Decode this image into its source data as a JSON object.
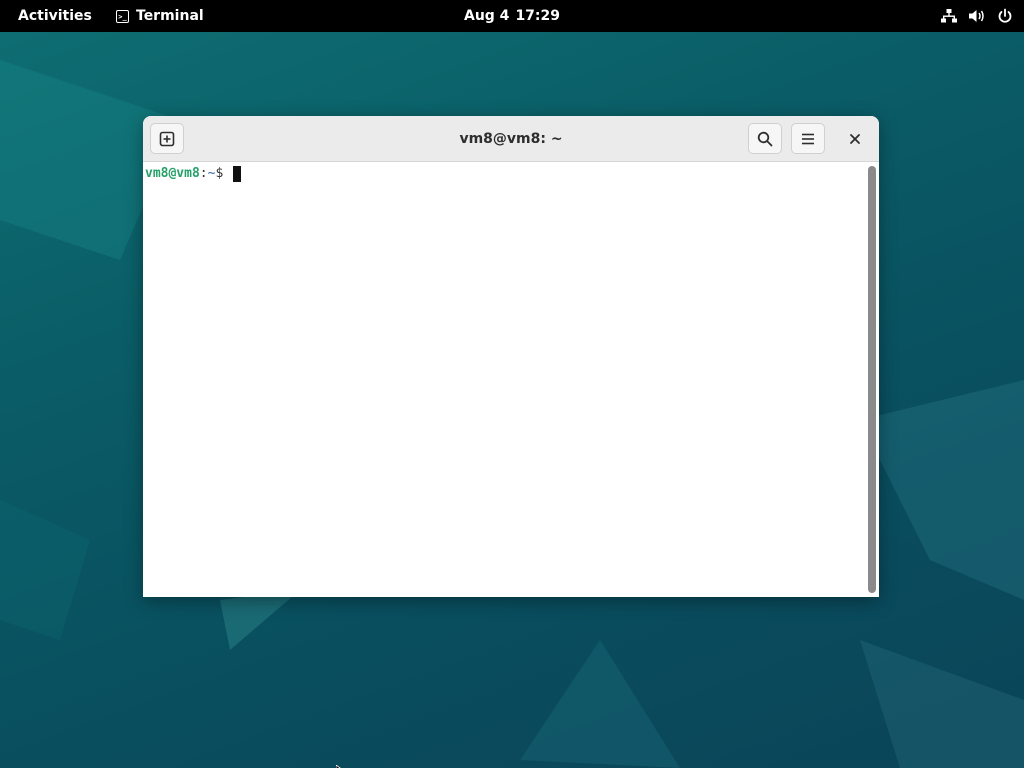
{
  "topbar": {
    "activities_label": "Activities",
    "app_name": "Terminal",
    "app_icon": "terminal-icon",
    "clock_date": "Aug 4",
    "clock_time": "17:29",
    "tray_icons": [
      "network-icon",
      "volume-icon",
      "power-icon"
    ]
  },
  "window": {
    "title": "vm8@vm8: ~",
    "buttons": {
      "new_tab_icon": "new-tab-icon",
      "search_icon": "search-icon",
      "menu_icon": "hamburger-menu-icon",
      "close_icon": "close-icon"
    }
  },
  "terminal": {
    "prompt_user_host": "vm8@vm8",
    "prompt_separator": ":",
    "prompt_path": "~",
    "prompt_symbol": "$ ",
    "input_text": ""
  },
  "colors": {
    "topbar_bg": "#000000",
    "desktop_bg": "#0a5c66",
    "headerbar_bg": "#ebebeb",
    "prompt_user_color": "#26a269",
    "prompt_path_color": "#3465a4"
  }
}
